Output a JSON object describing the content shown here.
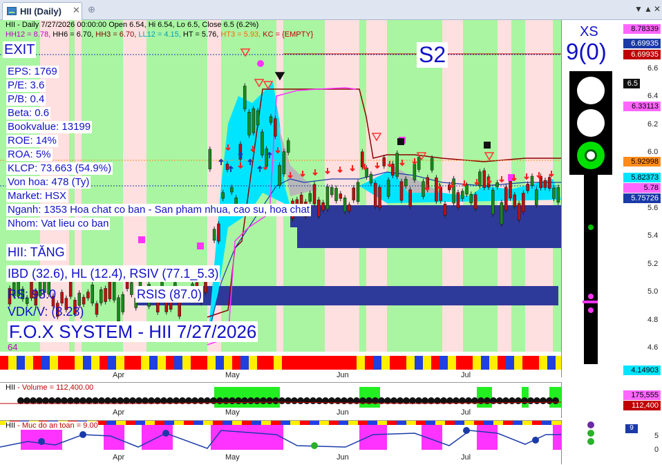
{
  "tab": {
    "title": "HII (Daily)",
    "close": "✕",
    "add": "⊕"
  },
  "window": {
    "down": "▼",
    "up": "▲",
    "close": "✕"
  },
  "header": {
    "line1": "HII - Daily 7/27/2026 00:00:00 Open 6.54, Hi 6.54, Lo 6.5, Close 6.5 (6.2%)",
    "hh12": "HH12 = 8.78,",
    "hh6": "HH6 = 6.70,",
    "hh3": "HH3 = 6.70,",
    "ll12": "LL12 = 4.15,",
    "ht": "HT  = 5.76,",
    "ht3": "HT3  = 5.93,",
    "kc": "KC = {EMPTY}"
  },
  "overlay": {
    "exit": "EXIT",
    "s2": "S2",
    "xs": "XS",
    "xs_value": "9(0)",
    "fundamentals": [
      "EPS: 1769",
      "P/E: 3.6",
      "P/B: 0.4",
      "Beta: 0.6",
      "Bookvalue: 13199",
      "ROE: 14%",
      "ROA: 5%",
      "KLCP: 73.663 (54.9%)",
      "Von hoa: 478 (Ty)",
      "Market: HSX",
      "Nganh: 1353 Hoa chat co ban - San pham nhua, cao su, hoa chat",
      "Nhom: Vat lieu co ban"
    ],
    "status": "HII: TĂNG",
    "ibd": "IBD (32.6), HL (12.4), RSIV (77.1_5.3)",
    "rs": "RS: 93.0",
    "rsis": "RSIS (87.0)",
    "vdk": "VDK/V:  (8.23)",
    "brand": "F.O.X SYSTEM - HII 7/27/2026",
    "small_num": "64"
  },
  "price_axis": {
    "ticks": [
      "6.6",
      "6.4",
      "6.2",
      "6.0",
      "5.8",
      "5.6",
      "5.4",
      "5.2",
      "5.0",
      "4.8",
      "4.6"
    ],
    "tags": [
      {
        "label": "8.78339",
        "bg": "#ff66ff",
        "fg": "#000"
      },
      {
        "label": "6.69935",
        "bg": "#1a3aa8",
        "fg": "#fff"
      },
      {
        "label": "6.69935",
        "bg": "#c00000",
        "fg": "#fff"
      },
      {
        "label": "6.5",
        "bg": "#111",
        "fg": "#fff"
      },
      {
        "label": "6.33113",
        "bg": "#ff66ff",
        "fg": "#000"
      },
      {
        "label": "5.92998",
        "bg": "#ff8c1a",
        "fg": "#000"
      },
      {
        "label": "5.82373",
        "bg": "#00e5ff",
        "fg": "#000"
      },
      {
        "label": "5.78",
        "bg": "#ff66ff",
        "fg": "#000"
      },
      {
        "label": "5.75726",
        "bg": "#1a3aa8",
        "fg": "#fff"
      },
      {
        "label": "4.14903",
        "bg": "#00e5ff",
        "fg": "#000"
      }
    ]
  },
  "months": [
    "Apr",
    "May",
    "Jun",
    "Jul"
  ],
  "volume": {
    "title": "HII",
    "label": " - Volume = 112,400.00",
    "tags": [
      {
        "label": "175,555",
        "bg": "#ff66ff",
        "fg": "#000"
      },
      {
        "label": "112,400",
        "bg": "#c00000",
        "fg": "#fff"
      }
    ]
  },
  "safety": {
    "title": "HII",
    "label": " - Muc do an toan = 9.00",
    "ticks": [
      "5",
      "0"
    ],
    "tag": "9"
  },
  "colors": {
    "green": "#a9f5a2",
    "pink": "#ffe0e0",
    "cloud": "#2e3a9a",
    "cyan": "#00e5ff"
  }
}
